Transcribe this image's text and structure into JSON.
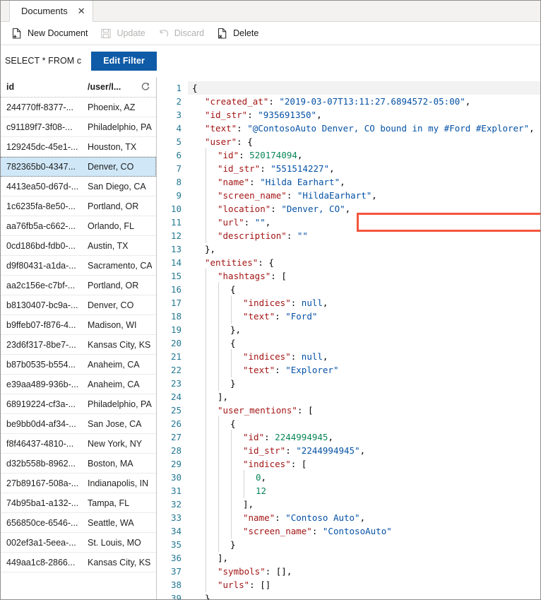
{
  "tab": {
    "label": "Documents",
    "close_icon": "close-icon"
  },
  "toolbar": {
    "items": [
      {
        "label": "New Document",
        "icon": "new-document-icon",
        "disabled": false
      },
      {
        "label": "Update",
        "icon": "save-floppy-icon",
        "disabled": true
      },
      {
        "label": "Discard",
        "icon": "undo-arrow-icon",
        "disabled": true
      },
      {
        "label": "Delete",
        "icon": "delete-document-icon",
        "disabled": false
      }
    ]
  },
  "filter": {
    "query_text": "SELECT * FROM c",
    "edit_button_label": "Edit Filter",
    "button_color": "#0f5ba7"
  },
  "grid": {
    "columns": [
      "id",
      "/user/l..."
    ],
    "refresh_icon": "refresh-icon",
    "selected_index": 3,
    "rows": [
      {
        "id": "244770ff-8377-...",
        "location": "Phoenix, AZ"
      },
      {
        "id": "c91189f7-3f08-...",
        "location": "Philadelphio, PA"
      },
      {
        "id": "129245dc-45e1-...",
        "location": "Houston, TX"
      },
      {
        "id": "782365b0-4347...",
        "location": "Denver, CO"
      },
      {
        "id": "4413ea50-d67d-...",
        "location": "San Diego, CA"
      },
      {
        "id": "1c6235fa-8e50-...",
        "location": "Portland, OR"
      },
      {
        "id": "aa76fb5a-c662-...",
        "location": "Orlando, FL"
      },
      {
        "id": "0cd186bd-fdb0-...",
        "location": "Austin, TX"
      },
      {
        "id": "d9f80431-a1da-...",
        "location": "Sacramento, CA"
      },
      {
        "id": "aa2c156e-c7bf-...",
        "location": "Portland, OR"
      },
      {
        "id": "b8130407-bc9a-...",
        "location": "Denver, CO"
      },
      {
        "id": "b9ffeb07-f876-4...",
        "location": "Madison, WI"
      },
      {
        "id": "23d6f317-8be7-...",
        "location": "Kansas City, KS"
      },
      {
        "id": "b87b0535-b554...",
        "location": "Anaheim, CA"
      },
      {
        "id": "e39aa489-936b-...",
        "location": "Anaheim, CA"
      },
      {
        "id": "68919224-cf3a-...",
        "location": "Philadelphio, PA"
      },
      {
        "id": "be9bb0d4-af34-...",
        "location": "San Jose, CA"
      },
      {
        "id": "f8f46437-4810-...",
        "location": "New York, NY"
      },
      {
        "id": "d32b558b-8962...",
        "location": "Boston, MA"
      },
      {
        "id": "27b89167-508a-...",
        "location": "Indianapolis, IN"
      },
      {
        "id": "74b95ba1-a132-...",
        "location": "Tampa, FL"
      },
      {
        "id": "656850ce-6546-...",
        "location": "Seattle, WA"
      },
      {
        "id": "002ef3a1-5eea-...",
        "location": "St. Louis, MO"
      },
      {
        "id": "449aa1c8-2866...",
        "location": "Kansas City, KS"
      }
    ]
  },
  "editor": {
    "current_line": 1,
    "highlight": {
      "line": 4,
      "color": "#f4553c"
    },
    "lines": [
      {
        "n": 1,
        "indent": 0,
        "tokens": [
          {
            "t": "p",
            "v": "{"
          }
        ]
      },
      {
        "n": 2,
        "indent": 1,
        "tokens": [
          {
            "t": "k",
            "v": "\"created_at\""
          },
          {
            "t": "p",
            "v": ": "
          },
          {
            "t": "s",
            "v": "\"2019-03-07T13:11:27.6894572-05:00\""
          },
          {
            "t": "p",
            "v": ","
          }
        ]
      },
      {
        "n": 3,
        "indent": 1,
        "tokens": [
          {
            "t": "k",
            "v": "\"id_str\""
          },
          {
            "t": "p",
            "v": ": "
          },
          {
            "t": "s",
            "v": "\"935691350\""
          },
          {
            "t": "p",
            "v": ","
          }
        ]
      },
      {
        "n": 4,
        "indent": 1,
        "tokens": [
          {
            "t": "k",
            "v": "\"text\""
          },
          {
            "t": "p",
            "v": ": "
          },
          {
            "t": "s",
            "v": "\"@ContosoAuto Denver, CO bound in my #Ford #Explorer\""
          },
          {
            "t": "p",
            "v": ","
          }
        ]
      },
      {
        "n": 5,
        "indent": 1,
        "tokens": [
          {
            "t": "k",
            "v": "\"user\""
          },
          {
            "t": "p",
            "v": ": {"
          }
        ]
      },
      {
        "n": 6,
        "indent": 2,
        "tokens": [
          {
            "t": "k",
            "v": "\"id\""
          },
          {
            "t": "p",
            "v": ": "
          },
          {
            "t": "n",
            "v": "520174094"
          },
          {
            "t": "p",
            "v": ","
          }
        ]
      },
      {
        "n": 7,
        "indent": 2,
        "tokens": [
          {
            "t": "k",
            "v": "\"id_str\""
          },
          {
            "t": "p",
            "v": ": "
          },
          {
            "t": "s",
            "v": "\"551514227\""
          },
          {
            "t": "p",
            "v": ","
          }
        ]
      },
      {
        "n": 8,
        "indent": 2,
        "tokens": [
          {
            "t": "k",
            "v": "\"name\""
          },
          {
            "t": "p",
            "v": ": "
          },
          {
            "t": "s",
            "v": "\"Hilda Earhart\""
          },
          {
            "t": "p",
            "v": ","
          }
        ]
      },
      {
        "n": 9,
        "indent": 2,
        "tokens": [
          {
            "t": "k",
            "v": "\"screen_name\""
          },
          {
            "t": "p",
            "v": ": "
          },
          {
            "t": "s",
            "v": "\"HildaEarhart\""
          },
          {
            "t": "p",
            "v": ","
          }
        ]
      },
      {
        "n": 10,
        "indent": 2,
        "tokens": [
          {
            "t": "k",
            "v": "\"location\""
          },
          {
            "t": "p",
            "v": ": "
          },
          {
            "t": "s",
            "v": "\"Denver, CO\""
          },
          {
            "t": "p",
            "v": ","
          }
        ]
      },
      {
        "n": 11,
        "indent": 2,
        "tokens": [
          {
            "t": "k",
            "v": "\"url\""
          },
          {
            "t": "p",
            "v": ": "
          },
          {
            "t": "s",
            "v": "\"\""
          },
          {
            "t": "p",
            "v": ","
          }
        ]
      },
      {
        "n": 12,
        "indent": 2,
        "tokens": [
          {
            "t": "k",
            "v": "\"description\""
          },
          {
            "t": "p",
            "v": ": "
          },
          {
            "t": "s",
            "v": "\"\""
          }
        ]
      },
      {
        "n": 13,
        "indent": 1,
        "tokens": [
          {
            "t": "p",
            "v": "},"
          }
        ]
      },
      {
        "n": 14,
        "indent": 1,
        "tokens": [
          {
            "t": "k",
            "v": "\"entities\""
          },
          {
            "t": "p",
            "v": ": {"
          }
        ]
      },
      {
        "n": 15,
        "indent": 2,
        "tokens": [
          {
            "t": "k",
            "v": "\"hashtags\""
          },
          {
            "t": "p",
            "v": ": ["
          }
        ]
      },
      {
        "n": 16,
        "indent": 3,
        "tokens": [
          {
            "t": "p",
            "v": "{"
          }
        ]
      },
      {
        "n": 17,
        "indent": 4,
        "tokens": [
          {
            "t": "k",
            "v": "\"indices\""
          },
          {
            "t": "p",
            "v": ": "
          },
          {
            "t": "s",
            "v": "null"
          },
          {
            "t": "p",
            "v": ","
          }
        ]
      },
      {
        "n": 18,
        "indent": 4,
        "tokens": [
          {
            "t": "k",
            "v": "\"text\""
          },
          {
            "t": "p",
            "v": ": "
          },
          {
            "t": "s",
            "v": "\"Ford\""
          }
        ]
      },
      {
        "n": 19,
        "indent": 3,
        "tokens": [
          {
            "t": "p",
            "v": "},"
          }
        ]
      },
      {
        "n": 20,
        "indent": 3,
        "tokens": [
          {
            "t": "p",
            "v": "{"
          }
        ]
      },
      {
        "n": 21,
        "indent": 4,
        "tokens": [
          {
            "t": "k",
            "v": "\"indices\""
          },
          {
            "t": "p",
            "v": ": "
          },
          {
            "t": "s",
            "v": "null"
          },
          {
            "t": "p",
            "v": ","
          }
        ]
      },
      {
        "n": 22,
        "indent": 4,
        "tokens": [
          {
            "t": "k",
            "v": "\"text\""
          },
          {
            "t": "p",
            "v": ": "
          },
          {
            "t": "s",
            "v": "\"Explorer\""
          }
        ]
      },
      {
        "n": 23,
        "indent": 3,
        "tokens": [
          {
            "t": "p",
            "v": "}"
          }
        ]
      },
      {
        "n": 24,
        "indent": 2,
        "tokens": [
          {
            "t": "p",
            "v": "],"
          }
        ]
      },
      {
        "n": 25,
        "indent": 2,
        "tokens": [
          {
            "t": "k",
            "v": "\"user_mentions\""
          },
          {
            "t": "p",
            "v": ": ["
          }
        ]
      },
      {
        "n": 26,
        "indent": 3,
        "tokens": [
          {
            "t": "p",
            "v": "{"
          }
        ]
      },
      {
        "n": 27,
        "indent": 4,
        "tokens": [
          {
            "t": "k",
            "v": "\"id\""
          },
          {
            "t": "p",
            "v": ": "
          },
          {
            "t": "n",
            "v": "2244994945"
          },
          {
            "t": "p",
            "v": ","
          }
        ]
      },
      {
        "n": 28,
        "indent": 4,
        "tokens": [
          {
            "t": "k",
            "v": "\"id_str\""
          },
          {
            "t": "p",
            "v": ": "
          },
          {
            "t": "s",
            "v": "\"2244994945\""
          },
          {
            "t": "p",
            "v": ","
          }
        ]
      },
      {
        "n": 29,
        "indent": 4,
        "tokens": [
          {
            "t": "k",
            "v": "\"indices\""
          },
          {
            "t": "p",
            "v": ": ["
          }
        ]
      },
      {
        "n": 30,
        "indent": 5,
        "tokens": [
          {
            "t": "n",
            "v": "0"
          },
          {
            "t": "p",
            "v": ","
          }
        ]
      },
      {
        "n": 31,
        "indent": 5,
        "tokens": [
          {
            "t": "n",
            "v": "12"
          }
        ]
      },
      {
        "n": 32,
        "indent": 4,
        "tokens": [
          {
            "t": "p",
            "v": "],"
          }
        ]
      },
      {
        "n": 33,
        "indent": 4,
        "tokens": [
          {
            "t": "k",
            "v": "\"name\""
          },
          {
            "t": "p",
            "v": ": "
          },
          {
            "t": "s",
            "v": "\"Contoso Auto\""
          },
          {
            "t": "p",
            "v": ","
          }
        ]
      },
      {
        "n": 34,
        "indent": 4,
        "tokens": [
          {
            "t": "k",
            "v": "\"screen_name\""
          },
          {
            "t": "p",
            "v": ": "
          },
          {
            "t": "s",
            "v": "\"ContosoAuto\""
          }
        ]
      },
      {
        "n": 35,
        "indent": 3,
        "tokens": [
          {
            "t": "p",
            "v": "}"
          }
        ]
      },
      {
        "n": 36,
        "indent": 2,
        "tokens": [
          {
            "t": "p",
            "v": "],"
          }
        ]
      },
      {
        "n": 37,
        "indent": 2,
        "tokens": [
          {
            "t": "k",
            "v": "\"symbols\""
          },
          {
            "t": "p",
            "v": ": [],"
          }
        ]
      },
      {
        "n": 38,
        "indent": 2,
        "tokens": [
          {
            "t": "k",
            "v": "\"urls\""
          },
          {
            "t": "p",
            "v": ": []"
          }
        ]
      },
      {
        "n": 39,
        "indent": 1,
        "tokens": [
          {
            "t": "p",
            "v": "},"
          }
        ]
      }
    ]
  }
}
